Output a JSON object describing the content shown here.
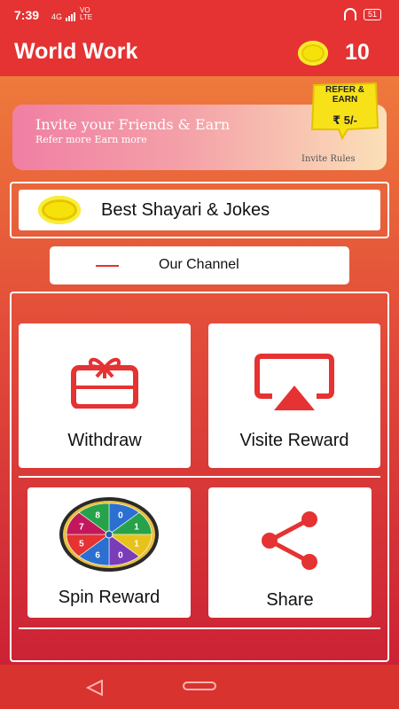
{
  "status_bar": {
    "time": "7:39",
    "network": "4G",
    "volte": "VO LTE",
    "battery": "51"
  },
  "app_bar": {
    "title": "World Work",
    "coin_icon": "coin-icon",
    "coins": "10"
  },
  "invite_banner": {
    "title": "Invite your Friends & Earn",
    "subtitle": "Refer more Earn more",
    "rules_label": "Invite Rules",
    "badge_text": "REFER & EARN",
    "badge_amount": "₹ 5/-"
  },
  "shayari": {
    "label": "Best Shayari & Jokes"
  },
  "channel": {
    "label": "Our Channel"
  },
  "cards": {
    "withdraw": {
      "label": "Withdraw",
      "icon": "gift-card-icon"
    },
    "visit": {
      "label": "Visite Reward",
      "icon": "airplay-icon"
    },
    "spin": {
      "label": "Spin Reward",
      "icon": "spin-wheel-icon",
      "wheel_numbers": [
        "0",
        "1",
        "1",
        "0",
        "6",
        "5",
        "7",
        "8"
      ]
    },
    "share": {
      "label": "Share",
      "icon": "share-icon"
    }
  },
  "colors": {
    "primary_red": "#e53232",
    "gradient_top": "#ee7a3c",
    "gradient_bottom": "#cc2235",
    "coin_yellow": "#f5e20a"
  }
}
